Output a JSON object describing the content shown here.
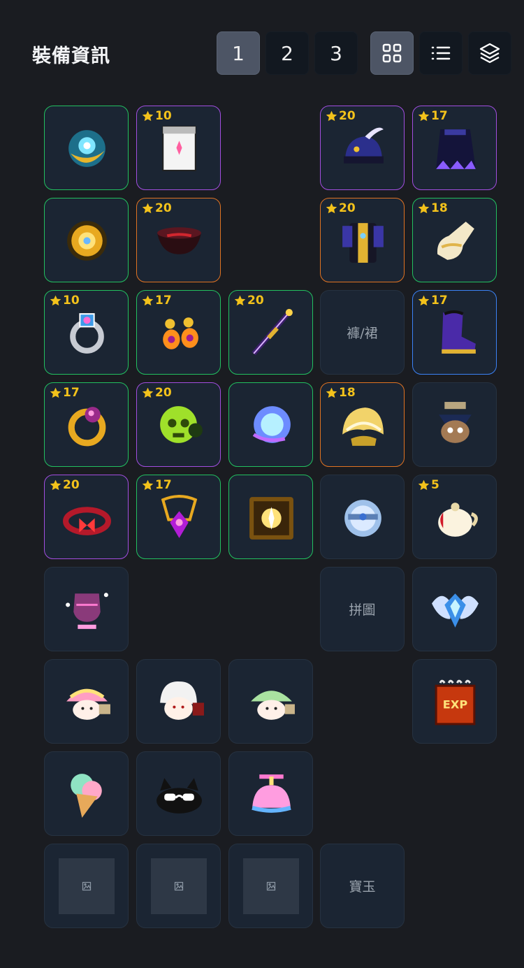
{
  "header": {
    "title": "裝備資訊",
    "pages": [
      "1",
      "2",
      "3"
    ],
    "active_page": "1",
    "view_modes": [
      "grid-view-icon",
      "list-view-icon",
      "layers-icon"
    ],
    "active_view": "grid-view-icon"
  },
  "colors": {
    "common": "#263241",
    "epic": "#a24ee0",
    "unique": "#e07322",
    "legendary": "#22c060",
    "rare": "#3b82f6",
    "star": "#f3c21b"
  },
  "equipment": {
    "slots": [
      {
        "name": "emblem-slot",
        "border": "legendary",
        "icon": "gold-crescent-emblem-icon"
      },
      {
        "name": "badge-slot",
        "border": "epic",
        "stars": "10",
        "icon": "white-scroll-card-icon"
      },
      {
        "name": "hat-slot",
        "border": "epic",
        "stars": "20",
        "icon": "dark-blue-helmet-icon"
      },
      {
        "name": "cape-slot",
        "border": "epic",
        "stars": "17",
        "icon": "dark-purple-cape-icon"
      },
      {
        "name": "emblem2-slot",
        "border": "legendary",
        "icon": "gold-sun-emblem-icon"
      },
      {
        "name": "face-slot",
        "border": "unique",
        "stars": "20",
        "icon": "dark-red-bowl-icon"
      },
      {
        "name": "top-slot",
        "border": "unique",
        "stars": "20",
        "icon": "dark-armor-top-icon"
      },
      {
        "name": "glove-slot",
        "border": "legendary",
        "stars": "18",
        "icon": "white-glove-icon"
      },
      {
        "name": "ring-slot",
        "border": "legendary",
        "stars": "10",
        "icon": "silver-gem-ring-icon"
      },
      {
        "name": "earring-slot",
        "border": "legendary",
        "stars": "17",
        "icon": "gold-earrings-icon"
      },
      {
        "name": "weapon-slot",
        "border": "legendary",
        "stars": "20",
        "icon": "purple-staff-icon"
      },
      {
        "name": "bottom-slot",
        "border": "common",
        "label": "褲/裙"
      },
      {
        "name": "shoes-slot",
        "border": "rare",
        "stars": "17",
        "icon": "purple-boots-icon"
      },
      {
        "name": "ring2-slot",
        "border": "legendary",
        "stars": "17",
        "icon": "gold-ring-icon"
      },
      {
        "name": "pocket-slot",
        "border": "epic",
        "stars": "20",
        "icon": "green-skull-icon"
      },
      {
        "name": "secondary-slot",
        "border": "legendary",
        "icon": "blue-orb-icon"
      },
      {
        "name": "shoulder-slot",
        "border": "unique",
        "stars": "18",
        "icon": "gold-shoulder-icon"
      },
      {
        "name": "android-slot",
        "border": "common",
        "icon": "android-character-icon"
      },
      {
        "name": "belt-slot",
        "border": "epic",
        "stars": "20",
        "icon": "red-belt-icon"
      },
      {
        "name": "pendant-slot",
        "border": "legendary",
        "stars": "17",
        "icon": "purple-pendant-icon"
      },
      {
        "name": "eye-slot",
        "border": "legendary",
        "icon": "gold-frame-icon"
      },
      {
        "name": "heart-slot",
        "border": "common",
        "icon": "blue-sphere-icon"
      },
      {
        "name": "totem-slot",
        "border": "common",
        "stars": "5",
        "icon": "white-teapot-icon"
      },
      {
        "name": "potion-slot",
        "border": "common",
        "icon": "purple-potion-icon"
      },
      {
        "name": "puzzle-slot",
        "border": "common",
        "label": "拼圖"
      },
      {
        "name": "medal-slot",
        "border": "common",
        "icon": "silver-wing-medal-icon"
      },
      {
        "name": "pet1-slot",
        "border": "common",
        "icon": "rainbow-mushroom-icon"
      },
      {
        "name": "pet2-slot",
        "border": "common",
        "icon": "white-hair-pet-icon"
      },
      {
        "name": "pet3-slot",
        "border": "common",
        "icon": "green-mushroom-icon"
      },
      {
        "name": "book-slot",
        "border": "common",
        "icon": "exp-book-icon"
      },
      {
        "name": "pet-item1-slot",
        "border": "common",
        "icon": "ice-cream-icon"
      },
      {
        "name": "pet-item2-slot",
        "border": "common",
        "icon": "black-cat-icon"
      },
      {
        "name": "pet-item3-slot",
        "border": "common",
        "icon": "propeller-hat-icon"
      },
      {
        "name": "empty1-slot",
        "border": "common",
        "icon": "broken-image-icon"
      },
      {
        "name": "empty2-slot",
        "border": "common",
        "icon": "broken-image-icon"
      },
      {
        "name": "empty3-slot",
        "border": "common",
        "icon": "broken-image-icon"
      },
      {
        "name": "gem-slot",
        "border": "common",
        "label": "寶玉"
      }
    ]
  }
}
